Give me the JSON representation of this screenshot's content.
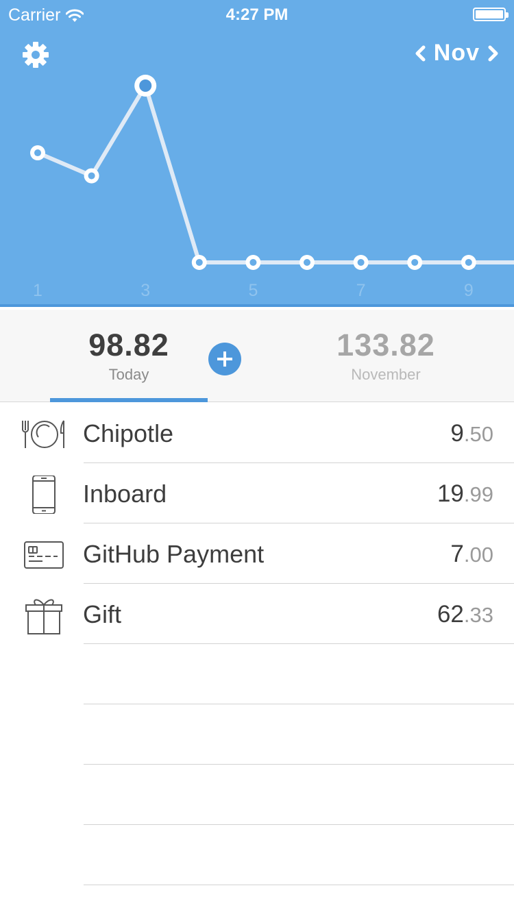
{
  "status": {
    "carrier": "Carrier",
    "time": "4:27 PM"
  },
  "header": {
    "month": "Nov",
    "accent": "#67ade8"
  },
  "chart_data": {
    "type": "line",
    "x": [
      1,
      2,
      3,
      4,
      5,
      6,
      7,
      8,
      9
    ],
    "values": [
      1.0,
      1.0,
      1.0,
      0,
      0,
      0,
      0,
      0,
      0
    ],
    "shape_note_excluded": true,
    "tick_labels": [
      "1",
      "3",
      "5",
      "7",
      "9"
    ],
    "highlight_index": 2
  },
  "summary": {
    "today_value": "98.82",
    "today_label": "Today",
    "month_value": "133.82",
    "month_label": "November"
  },
  "expenses": [
    {
      "name": "Chipotle",
      "whole": "9",
      "cents": ".50",
      "icon": "plate-cutlery-icon"
    },
    {
      "name": "Inboard",
      "whole": "19",
      "cents": ".99",
      "icon": "phone-icon"
    },
    {
      "name": "GitHub Payment",
      "whole": "7",
      "cents": ".00",
      "icon": "credit-card-icon"
    },
    {
      "name": "Gift",
      "whole": "62",
      "cents": ".33",
      "icon": "gift-icon"
    }
  ]
}
